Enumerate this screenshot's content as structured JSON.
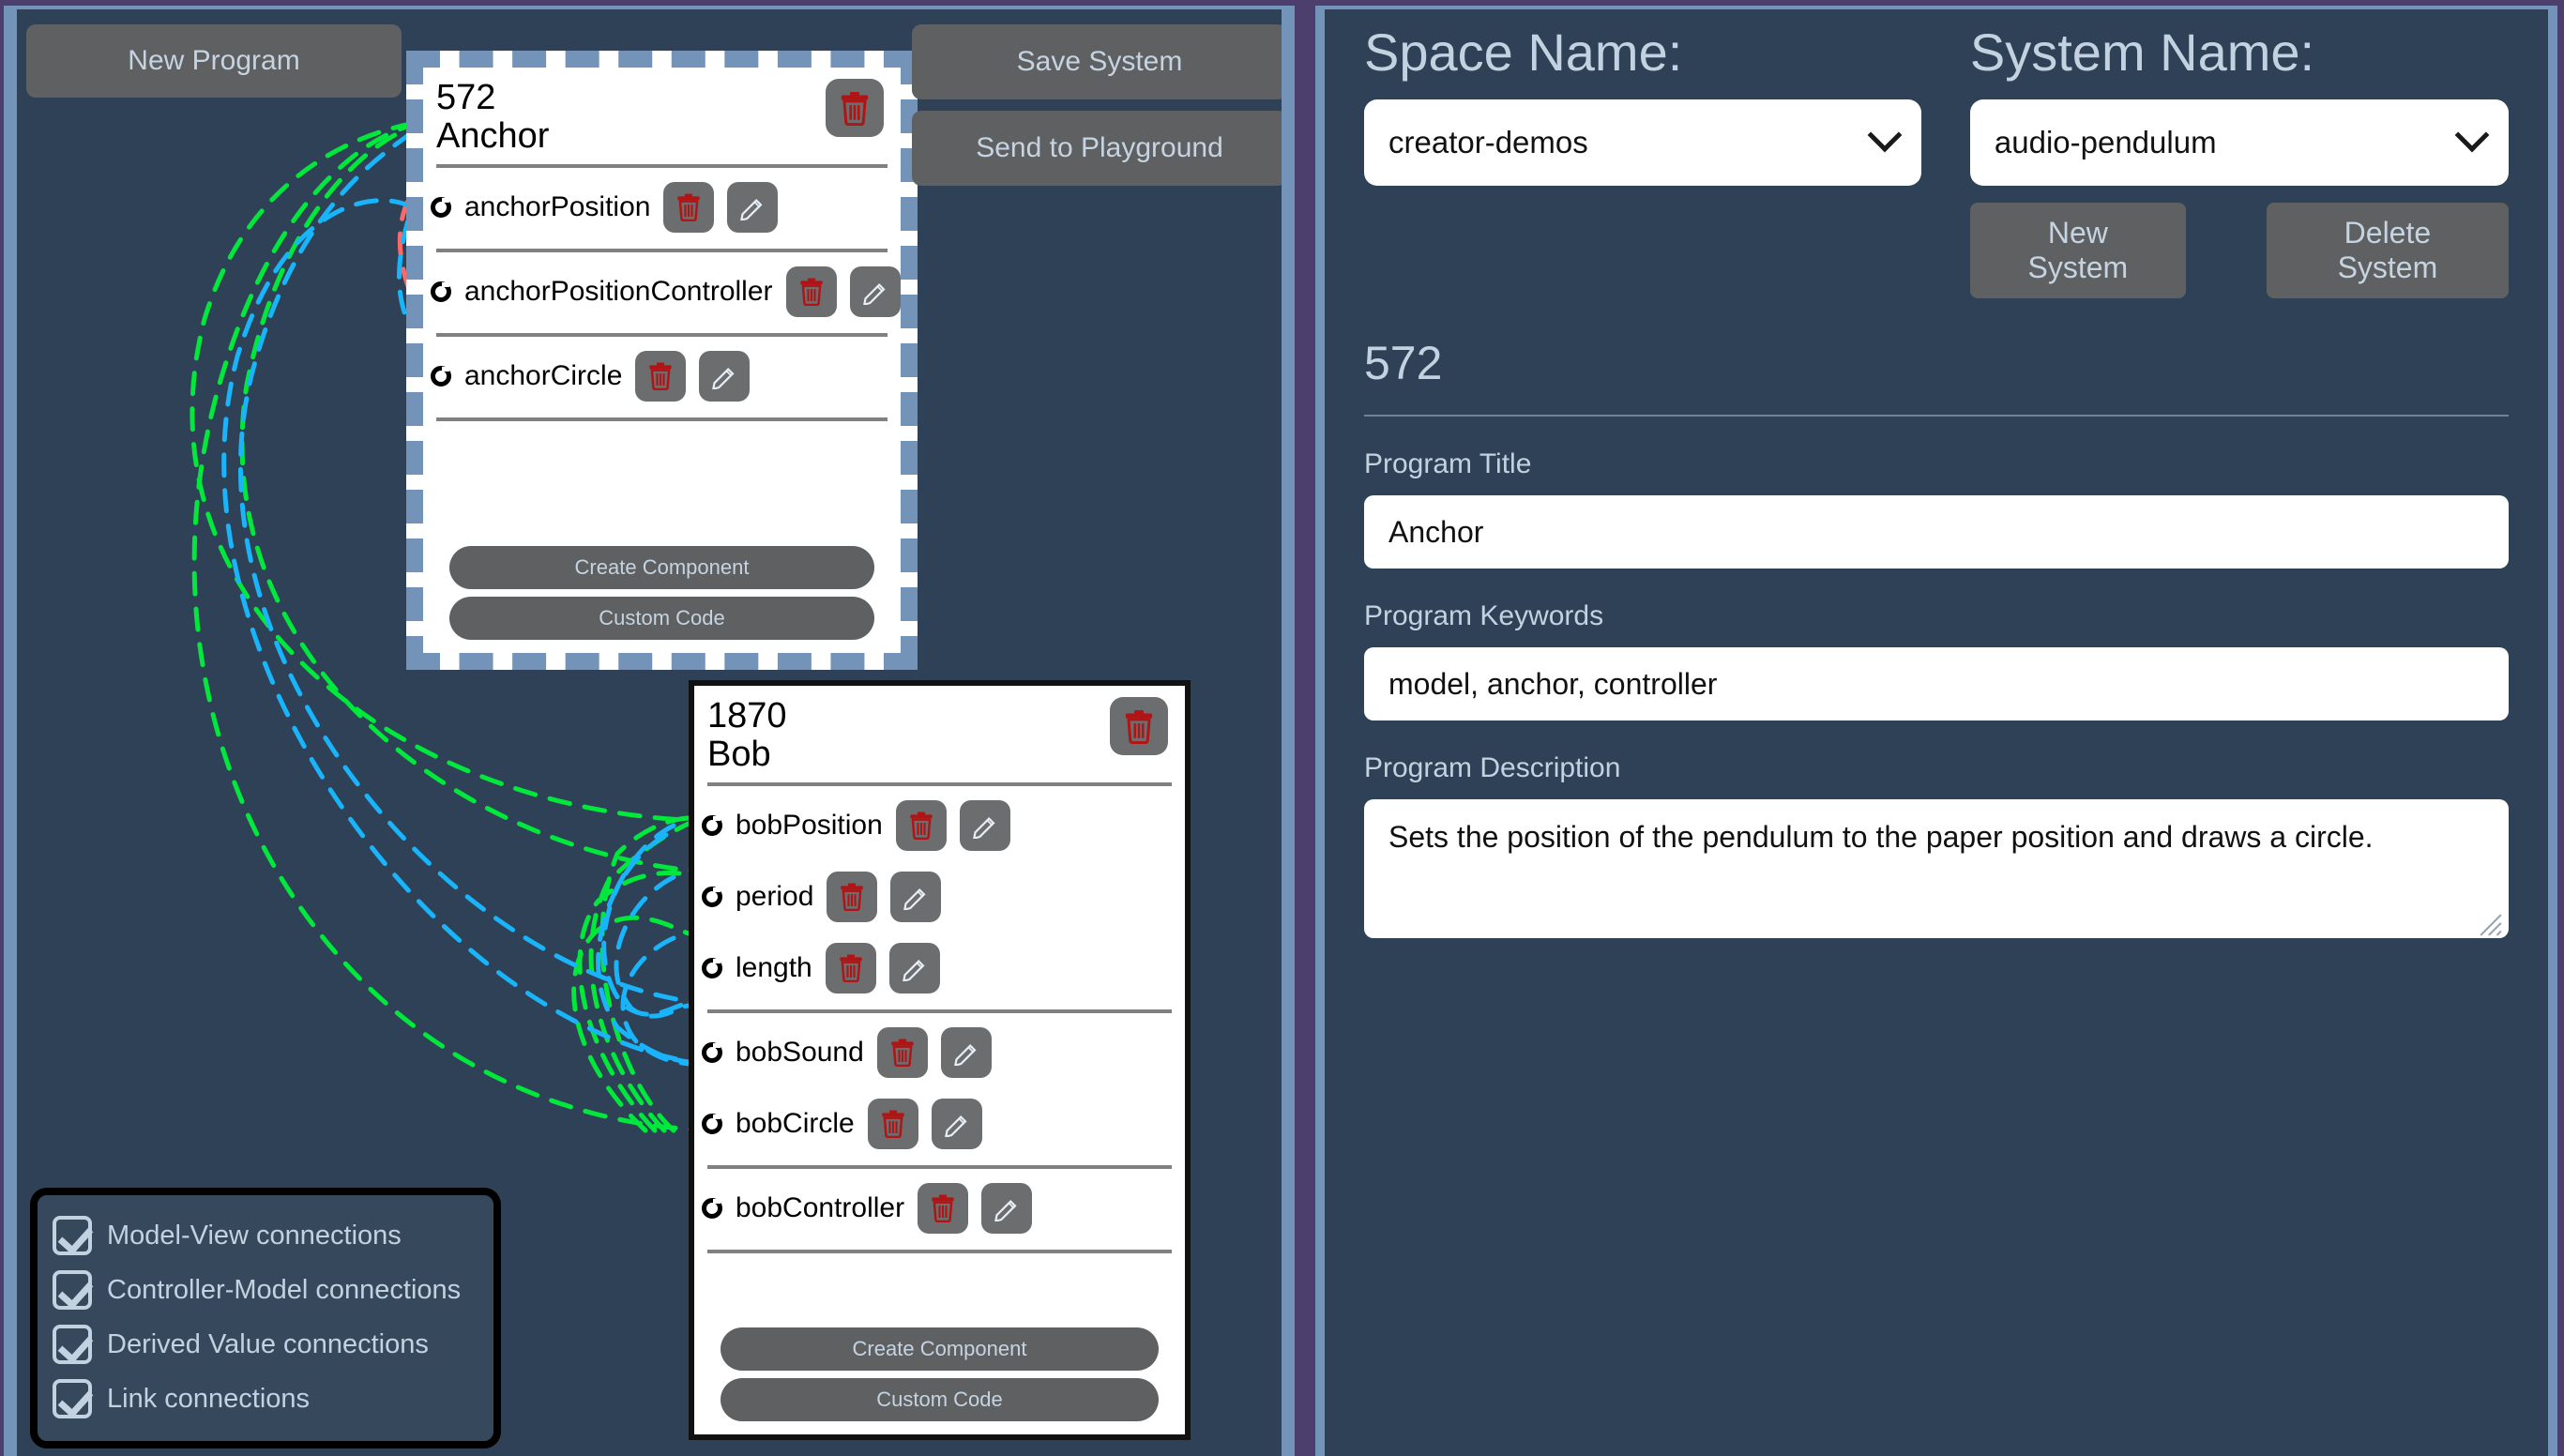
{
  "toolbar": {
    "new_program": "New Program",
    "save_system": "Save System",
    "send_playground": "Send to Playground"
  },
  "programs": [
    {
      "id": "572",
      "title": "Anchor",
      "selected": true,
      "delete_icon": "trash-icon",
      "groups": [
        {
          "rows": [
            {
              "label": "anchorPosition"
            }
          ]
        },
        {
          "rows": [
            {
              "label": "anchorPositionController"
            }
          ]
        },
        {
          "rows": [
            {
              "label": "anchorCircle"
            }
          ]
        }
      ],
      "create_component": "Create Component",
      "custom_code": "Custom Code"
    },
    {
      "id": "1870",
      "title": "Bob",
      "selected": false,
      "delete_icon": "trash-icon",
      "groups": [
        {
          "rows": [
            {
              "label": "bobPosition"
            },
            {
              "label": "period"
            },
            {
              "label": "length"
            }
          ]
        },
        {
          "rows": [
            {
              "label": "bobSound"
            },
            {
              "label": "bobCircle"
            }
          ]
        },
        {
          "rows": [
            {
              "label": "bobController"
            }
          ]
        }
      ],
      "create_component": "Create Component",
      "custom_code": "Custom Code"
    }
  ],
  "legend": {
    "items": [
      {
        "label": "Model-View connections",
        "checked": true,
        "color": "#00e83c"
      },
      {
        "label": "Controller-Model connections",
        "checked": true,
        "color": "#fb6a6a"
      },
      {
        "label": "Derived Value connections",
        "checked": true,
        "color": "#19b4fa"
      },
      {
        "label": "Link connections",
        "checked": true,
        "color": "#19b4fa"
      }
    ]
  },
  "inspector": {
    "space_name_label": "Space Name:",
    "space_name_value": "creator-demos",
    "system_name_label": "System Name:",
    "system_name_value": "audio-pendulum",
    "new_system": "New System",
    "delete_system": "Delete System",
    "program_id": "572",
    "program_title_label": "Program Title",
    "program_title_value": "Anchor",
    "program_keywords_label": "Program Keywords",
    "program_keywords_value": "model, anchor, controller",
    "program_description_label": "Program Description",
    "program_description_value": "Sets the position of the pendulum to the paper position and draws a circle."
  },
  "colors": {
    "panel_bg": "#2e4156",
    "panel_border": "#7394b8",
    "page_bg": "#4c3f6d",
    "button_bg": "#5e6062",
    "button_text": "#c6d4e2",
    "model_view": "#00e83c",
    "controller_model": "#fb6a6a",
    "derived_value": "#19b4fa",
    "trash_red": "#b01414"
  }
}
